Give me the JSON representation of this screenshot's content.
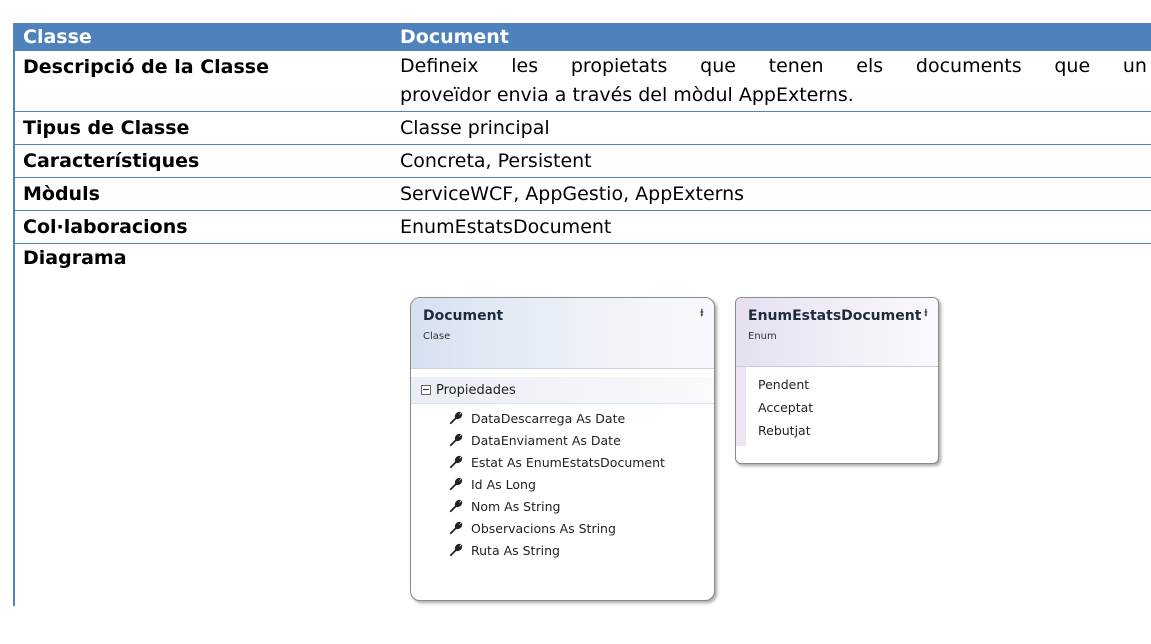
{
  "header": {
    "col1": "Classe",
    "col2": "Document"
  },
  "rows": [
    {
      "label": "Descripció de la Classe",
      "line1": [
        "Defineix",
        "les",
        "propietats",
        "que",
        "tenen",
        "els",
        "documents",
        "que",
        "un"
      ],
      "line2": "proveïdor envia a través del mòdul AppExterns."
    },
    {
      "label": "Tipus de Classe",
      "value": "Classe principal"
    },
    {
      "label": "Característiques",
      "value": "Concreta, Persistent"
    },
    {
      "label": "Mòduls",
      "value": "ServiceWCF, AppGestio, AppExterns"
    },
    {
      "label": "Col·laboracions",
      "value": "EnumEstatsDocument"
    },
    {
      "label": "Diagrama"
    }
  ],
  "diagram": {
    "class_box": {
      "name": "Document",
      "kind": "Clase",
      "section": "Propiedades",
      "properties": [
        "DataDescarrega As Date",
        "DataEnviament As Date",
        "Estat As EnumEstatsDocument",
        "Id As Long",
        "Nom As String",
        "Observacions As String",
        "Ruta As String"
      ],
      "property_icon": "wrench-icon",
      "collapse_icon": "double-chevron-up-icon"
    },
    "enum_box": {
      "name": "EnumEstatsDocument",
      "kind": "Enum",
      "values": [
        "Pendent",
        "Acceptat",
        "Rebutjat"
      ],
      "collapse_icon": "double-chevron-up-icon"
    }
  },
  "colors": {
    "header_bg": "#4f81bd",
    "header_text": "#ffffff",
    "border": "#4f81bd"
  }
}
